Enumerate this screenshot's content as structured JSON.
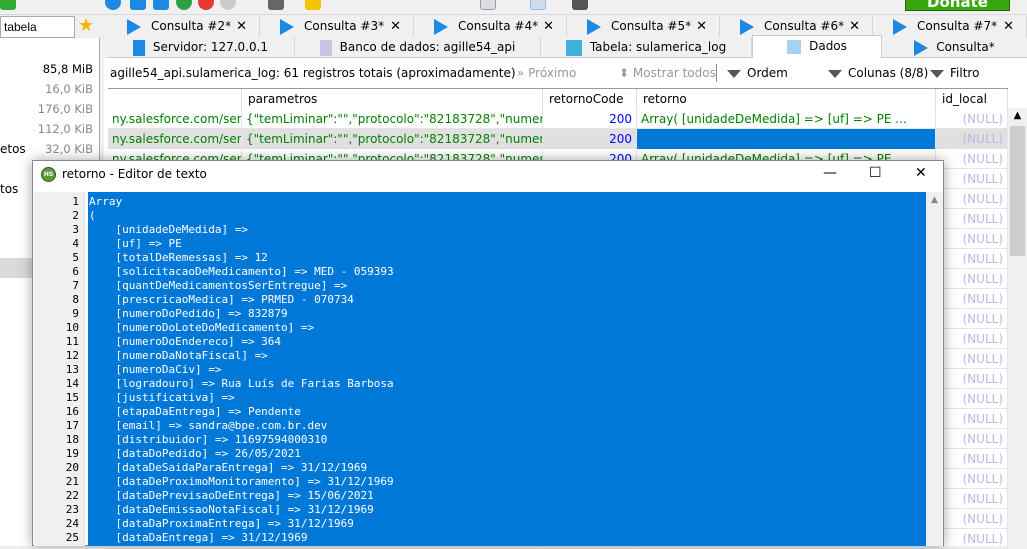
{
  "toolbar": {
    "donate_label": "Donate"
  },
  "sidebar": {
    "search_value": "tabela",
    "sizes": [
      "85,8 MiB",
      "16,0 KiB",
      "176,0 KiB",
      "112,0 KiB",
      "32,0 KiB"
    ],
    "partial_items": [
      "etos",
      "tos"
    ]
  },
  "query_tabs": [
    {
      "label": "Consulta #2*"
    },
    {
      "label": "Consulta #3*"
    },
    {
      "label": "Consulta #4*"
    },
    {
      "label": "Consulta #5*"
    },
    {
      "label": "Consulta #6*"
    },
    {
      "label": "Consulta #7*"
    }
  ],
  "main_tabs": [
    {
      "label": "Servidor: 127.0.0.1"
    },
    {
      "label": "Banco de dados: agille54_api"
    },
    {
      "label": "Tabela: sulamerica_log"
    },
    {
      "label": "Dados"
    },
    {
      "label": "Consulta*"
    }
  ],
  "data_toolbar": {
    "info": "agille54_api.sulamerica_log: 61 registros totais (aproximadamente)",
    "next": "Próximo",
    "show_all": "Mostrar todos",
    "order": "Ordem",
    "columns": "Colunas (8/8)",
    "filter": "Filtro"
  },
  "grid": {
    "headers": [
      "",
      "parametros",
      "retornoCode",
      "retorno",
      "id_local"
    ],
    "rows": [
      {
        "url": "ny.salesforce.com/ser...",
        "parametros": "{\"temLiminar\":\"\",\"protocolo\":\"82183728\",\"numeroD...",
        "code": "200",
        "retorno": "Array(    [unidadeDeMedida] =>      [uf] => PE  ...",
        "id_local": "(NULL)"
      },
      {
        "url": "ny.salesforce.com/ser...",
        "parametros": "{\"temLiminar\":\"\",\"protocolo\":\"82183728\",\"numeroD...",
        "code": "200",
        "retorno": "",
        "id_local": "(NULL)"
      },
      {
        "url": "ny.salesforce.com/ser...",
        "parametros": "{\"temLiminar\":\"\",\"protocolo\":\"82183728\",\"numeroD...",
        "code": "200",
        "retorno": "Array(    [unidadeDeMedida] =>      [uf] => PE",
        "id_local": "(NULL)"
      }
    ],
    "hidden_null": "(NULL)"
  },
  "dialog": {
    "title": "retorno - Editor de texto",
    "lines": [
      "Array",
      "(",
      "    [unidadeDeMedida] =>",
      "    [uf] => PE",
      "    [totalDeRemessas] => 12",
      "    [solicitacaoDeMedicamento] => MED - 059393",
      "    [quantDeMedicamentosSerEntregue] =>",
      "    [prescricaoMedica] => PRMED - 070734",
      "    [numeroDoPedido] => 832879",
      "    [numeroDoLoteDoMedicamento] =>",
      "    [numeroDoEndereco] => 364",
      "    [numeroDaNotaFiscal] =>",
      "    [numeroDaCiv] =>",
      "    [logradouro] => Rua Luís de Farias Barbosa",
      "    [justificativa] =>",
      "    [etapaDaEntrega] => Pendente",
      "    [email] => sandra@bpe.com.br.dev",
      "    [distribuidor] => 11697594000310",
      "    [dataDoPedido] => 26/05/2021",
      "    [dataDeSaidaParaEntrega] => 31/12/1969",
      "    [dataDeProximoMonitoramento] => 31/12/1969",
      "    [dataDePrevisaoDeEntrega] => 15/06/2021",
      "    [dataDeEmissaoNotaFiscal] => 31/12/1969",
      "    [dataDaProximaEntrega] => 31/12/1969",
      "    [dataDaEntrega] => 31/12/1969"
    ]
  },
  "colors": {
    "selection": "#0078d7",
    "green_text": "#008000",
    "number": "#0000ff",
    "null": "#c0b6e6",
    "donate": "#3aa60f"
  }
}
